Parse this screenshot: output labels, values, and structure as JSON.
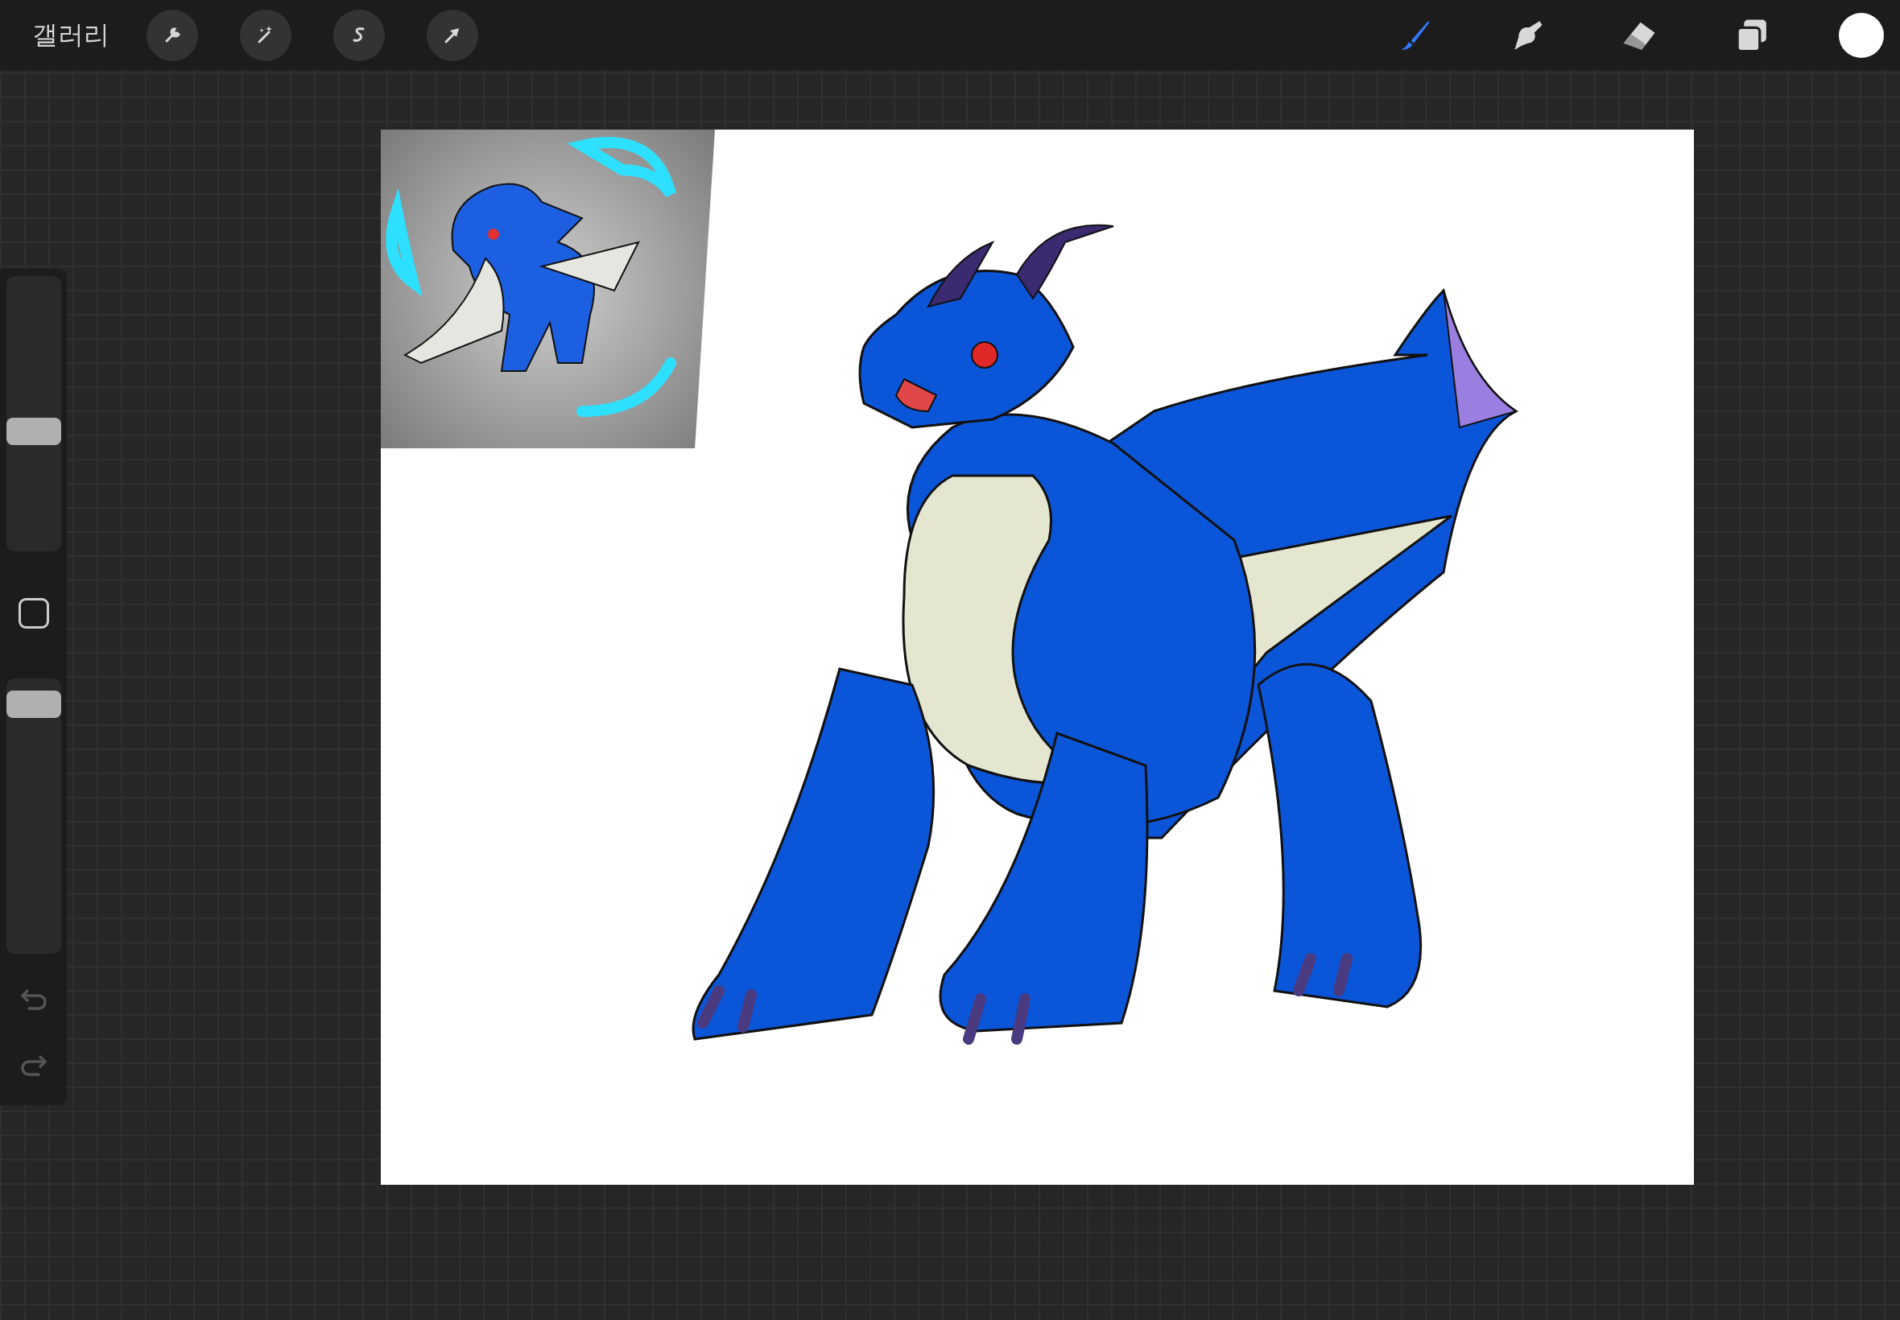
{
  "top_bar": {
    "gallery_label": "갤러리",
    "left_tools": [
      {
        "kind": "actions",
        "selected": false
      },
      {
        "kind": "adjustments",
        "selected": false
      },
      {
        "kind": "selection",
        "selected": false
      },
      {
        "kind": "transform",
        "selected": false
      }
    ],
    "right_tools": [
      {
        "kind": "brush",
        "selected": true
      },
      {
        "kind": "smudge",
        "selected": false
      },
      {
        "kind": "eraser",
        "selected": false
      },
      {
        "kind": "layers",
        "selected": false
      }
    ]
  },
  "sidebar": {
    "brush_size": {
      "level": 0.43
    },
    "opacity": {
      "level": 0.95
    }
  }
}
